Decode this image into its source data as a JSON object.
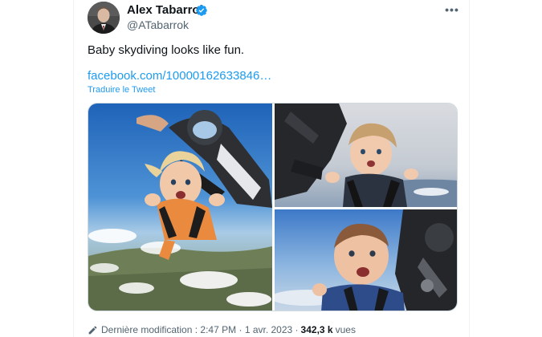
{
  "author": {
    "name": "Alex Tabarrok",
    "handle": "@ATabarrok",
    "verified": true
  },
  "tweet": {
    "text": "Baby skydiving looks like fun.",
    "link": "facebook.com/10000162633846…",
    "translate_label": "Traduire le Tweet"
  },
  "media": [
    {
      "description": "baby-skydiving-with-instructor"
    },
    {
      "description": "baby-skydiving-close-up-clouds"
    },
    {
      "description": "baby-skydiving-side-view"
    }
  ],
  "footer": {
    "edited_label": "Dernière modification",
    "separator": ":",
    "time": "2:47 PM",
    "dot": "·",
    "date": "1 avr. 2023",
    "views_count": "342,3 k",
    "views_label": "vues"
  },
  "colors": {
    "link": "#1d9bf0",
    "text": "#0f1419",
    "secondary": "#536471",
    "verified": "#1d9bf0"
  },
  "icons": {
    "verified": "verified-badge-icon",
    "more": "more-options-icon",
    "edit": "pencil-icon"
  }
}
